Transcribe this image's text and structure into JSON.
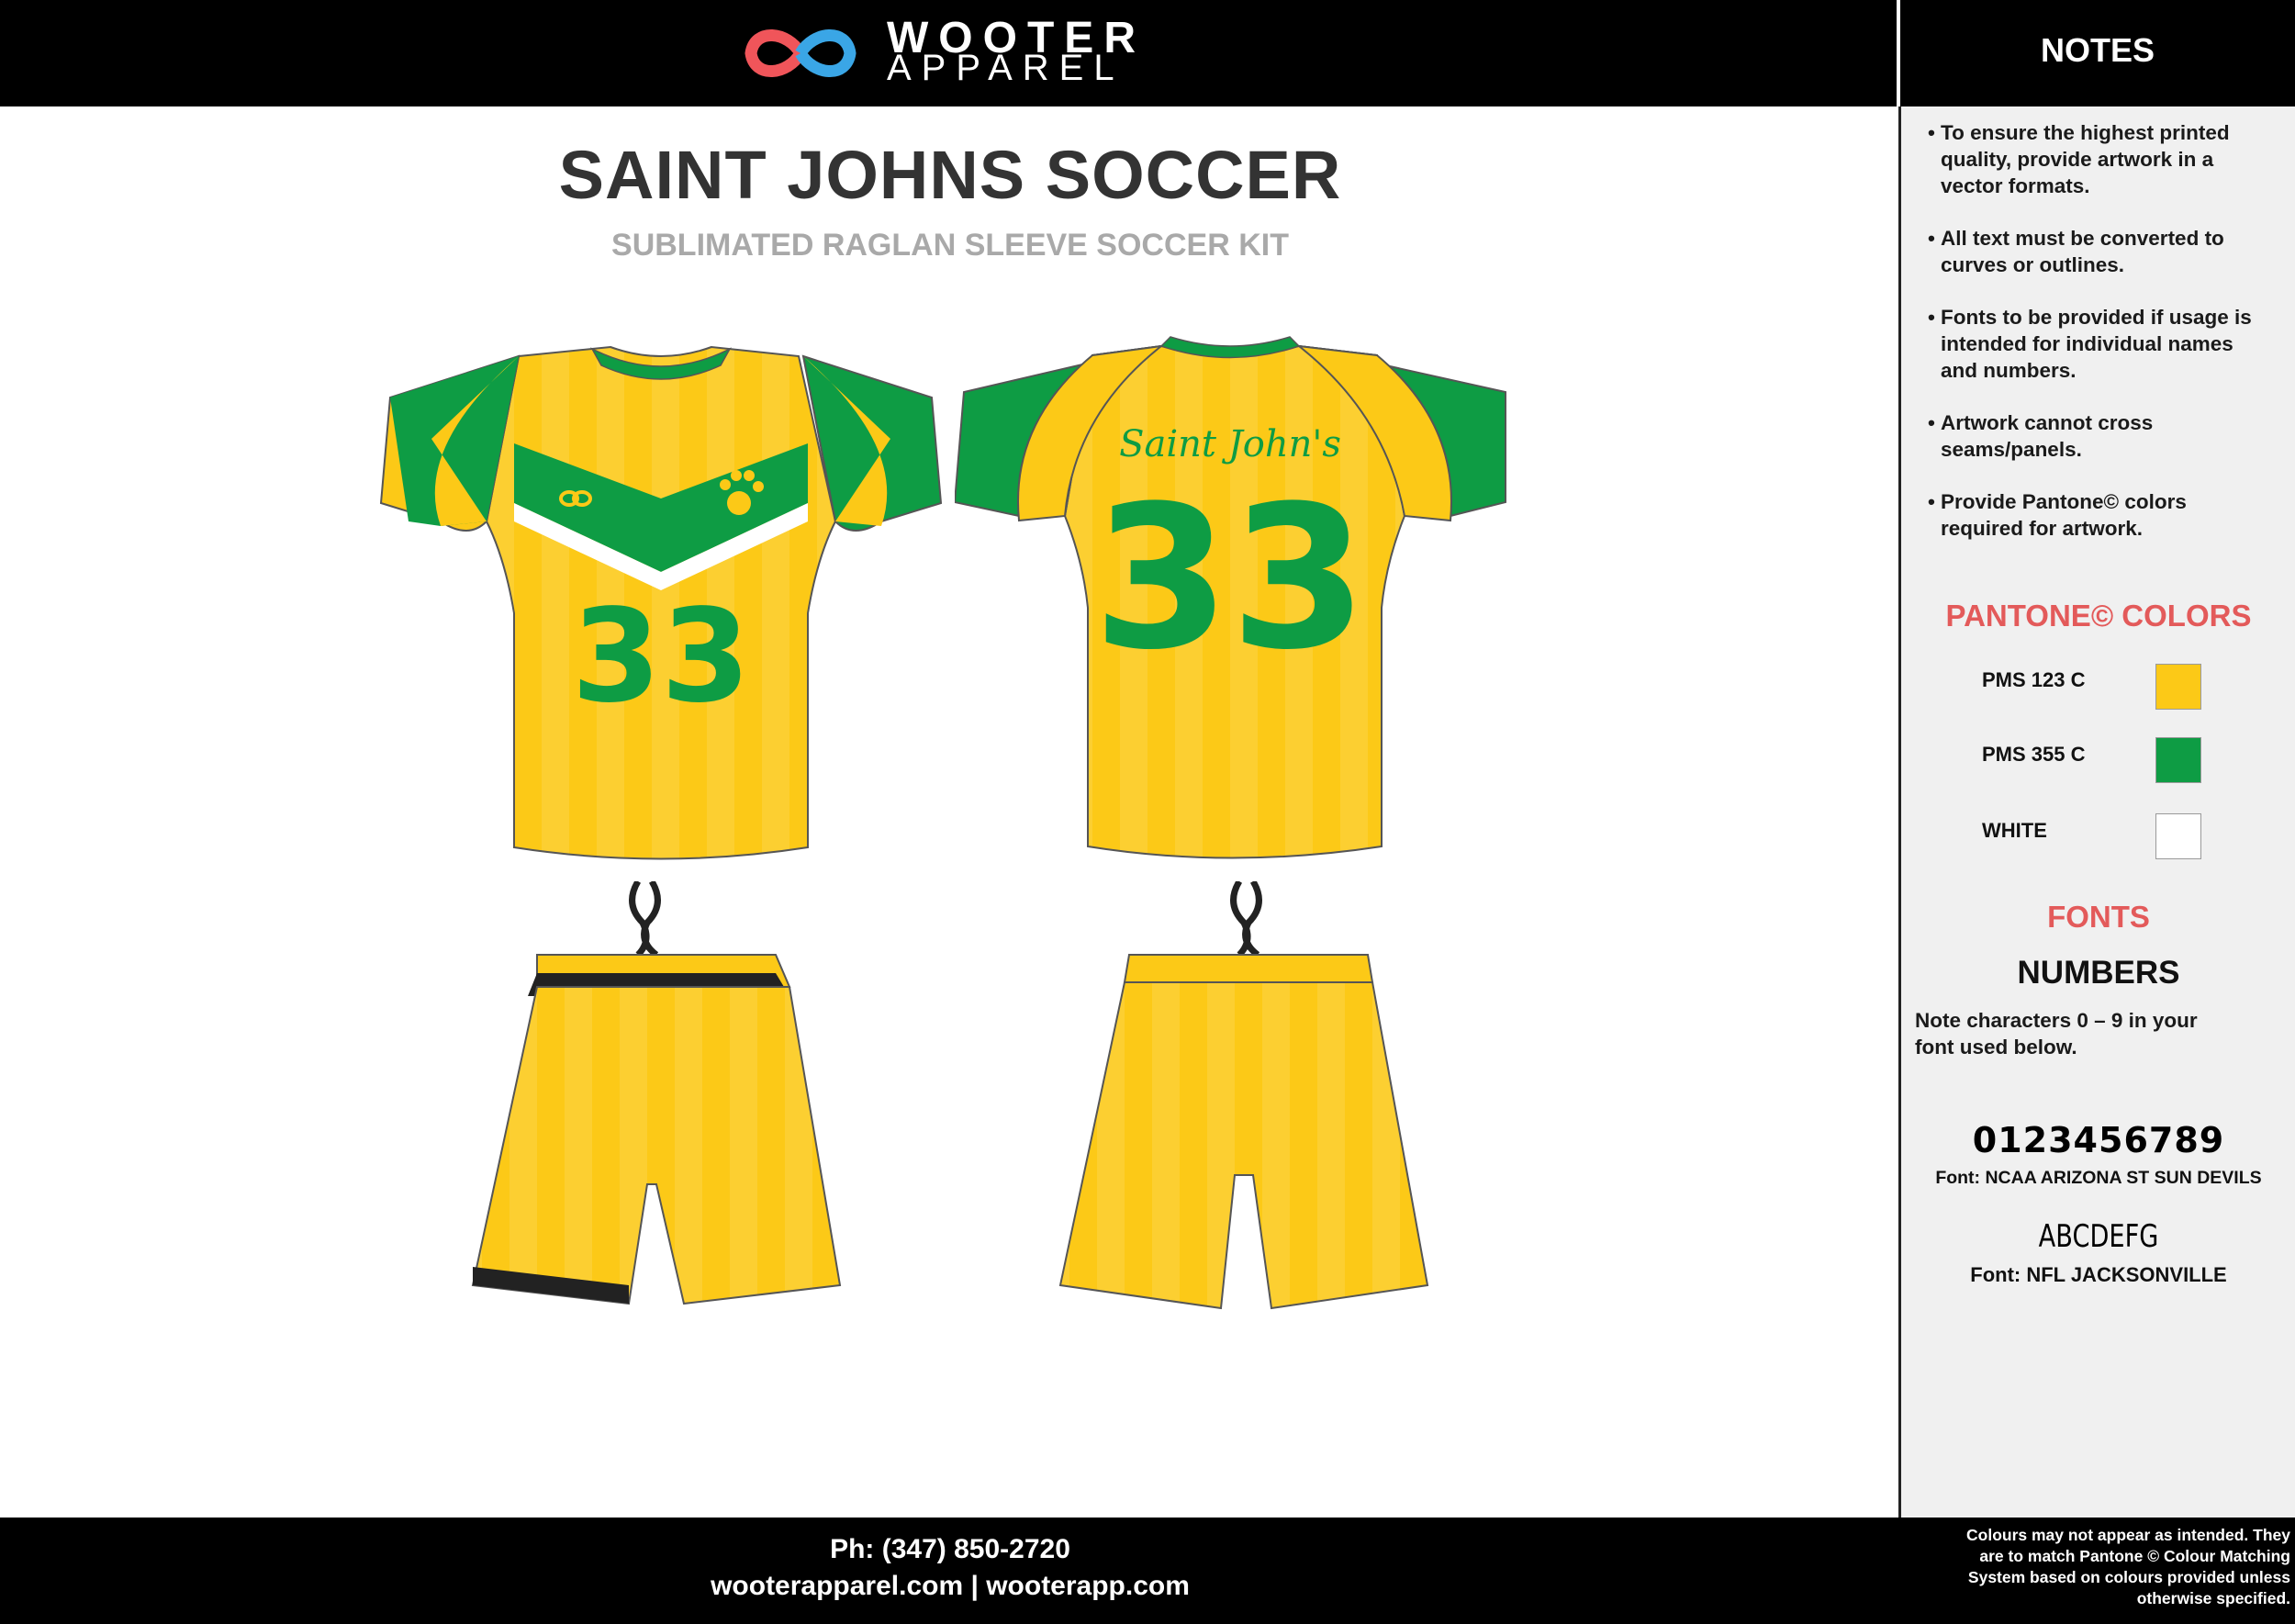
{
  "header": {
    "brand_top": "WOOTER",
    "brand_bottom": "APPAREL",
    "notes_title": "NOTES"
  },
  "main": {
    "title": "SAINT JOHNS SOCCER",
    "subtitle": "SUBLIMATED RAGLAN SLEEVE SOCCER KIT"
  },
  "jersey": {
    "front_number": "33",
    "back_name": "Saint John's",
    "back_number": "33"
  },
  "notes": {
    "items": [
      [
        "To ensure the highest printed",
        "quality, provide artwork in  a",
        "vector formats."
      ],
      [
        "All text must be converted to",
        "curves or outlines."
      ],
      [
        "Fonts to be provided if usage is",
        "intended for individual names",
        "and numbers."
      ],
      [
        "Artwork cannot cross",
        "seams/panels."
      ],
      [
        "Provide Pantone© colors",
        "required for artwork."
      ]
    ]
  },
  "pantone": {
    "title": "PANTONE©  COLORS",
    "colors": [
      {
        "label": "PMS 123 C",
        "hex": "#fcc917"
      },
      {
        "label": "PMS 355 C",
        "hex": "#0e9c44"
      },
      {
        "label": "WHITE",
        "hex": "#ffffff"
      }
    ]
  },
  "fonts": {
    "title": "FONTS",
    "numbers_heading": "NUMBERS",
    "numbers_note": [
      "Note characters 0 – 9 in your",
      "font used below."
    ],
    "number_sample": "0123456789",
    "number_font": "Font: NCAA ARIZONA ST SUN DEVILS",
    "letter_sample": "ABCDEFG",
    "letter_font": "Font: NFL JACKSONVILLE"
  },
  "footer": {
    "phone": "Ph: (347) 850-2720",
    "websites": "wooterapparel.com | wooterapp.com",
    "disclaimer": [
      "Colours may not appear as intended. They",
      "are to match Pantone © Colour Matching",
      "System based on colours provided unless",
      "otherwise specified."
    ]
  },
  "colors": {
    "accent_red": "#e35a5a",
    "yellow": "#fcc917",
    "green": "#0e9c44",
    "logo_red": "#f0555a",
    "logo_blue": "#3aa6e6"
  }
}
